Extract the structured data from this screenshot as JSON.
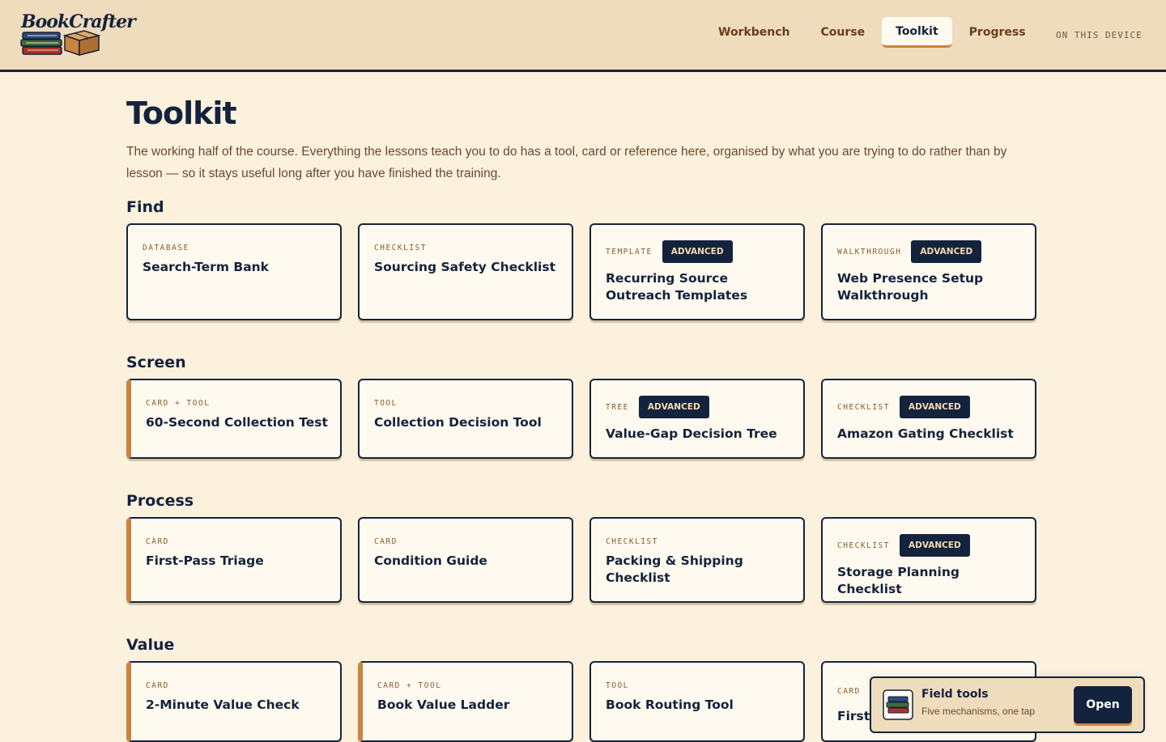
{
  "brand": {
    "name": "BookCrafter"
  },
  "nav": {
    "items": [
      {
        "label": "Workbench",
        "active": false
      },
      {
        "label": "Course",
        "active": false
      },
      {
        "label": "Toolkit",
        "active": true
      },
      {
        "label": "Progress",
        "active": false
      }
    ],
    "device_label": "ON THIS DEVICE"
  },
  "page": {
    "title": "Toolkit",
    "intro": "The working half of the course. Everything the lessons teach you to do has a tool, card or reference here, organised by what you are trying to do rather than by lesson — so it stays useful long after you have finished the training."
  },
  "sections": [
    {
      "title": "Find",
      "cards": [
        {
          "kind": "DATABASE",
          "title": "Search-Term Bank",
          "badge": "",
          "accent": false
        },
        {
          "kind": "CHECKLIST",
          "title": "Sourcing Safety Checklist",
          "badge": "",
          "accent": false
        },
        {
          "kind": "TEMPLATE",
          "title": "Recurring Source Outreach Templates",
          "badge": "ADVANCED",
          "accent": false
        },
        {
          "kind": "WALKTHROUGH",
          "title": "Web Presence Setup Walkthrough",
          "badge": "ADVANCED",
          "accent": false
        }
      ]
    },
    {
      "title": "Screen",
      "cards": [
        {
          "kind": "CARD + TOOL",
          "title": "60-Second Collection Test",
          "badge": "",
          "accent": true
        },
        {
          "kind": "TOOL",
          "title": "Collection Decision Tool",
          "badge": "",
          "accent": false
        },
        {
          "kind": "TREE",
          "title": "Value-Gap Decision Tree",
          "badge": "ADVANCED",
          "accent": false
        },
        {
          "kind": "CHECKLIST",
          "title": "Amazon Gating Checklist",
          "badge": "ADVANCED",
          "accent": false
        }
      ]
    },
    {
      "title": "Process",
      "cards": [
        {
          "kind": "CARD",
          "title": "First-Pass Triage",
          "badge": "",
          "accent": true
        },
        {
          "kind": "CARD",
          "title": "Condition Guide",
          "badge": "",
          "accent": false
        },
        {
          "kind": "CHECKLIST",
          "title": "Packing & Shipping Checklist",
          "badge": "",
          "accent": false
        },
        {
          "kind": "CHECKLIST",
          "title": "Storage Planning Checklist",
          "badge": "ADVANCED",
          "accent": false
        }
      ]
    },
    {
      "title": "Value",
      "cards": [
        {
          "kind": "CARD",
          "title": "2-Minute Value Check",
          "badge": "",
          "accent": true
        },
        {
          "kind": "CARD + TOOL",
          "title": "Book Value Ladder",
          "badge": "",
          "accent": true
        },
        {
          "kind": "TOOL",
          "title": "Book Routing Tool",
          "badge": "",
          "accent": false
        },
        {
          "kind": "CARD",
          "title": "First",
          "badge": "",
          "accent": false
        }
      ]
    }
  ],
  "field_tools": {
    "title": "Field tools",
    "subtitle": "Five mechanisms, one tap",
    "button": "Open"
  }
}
